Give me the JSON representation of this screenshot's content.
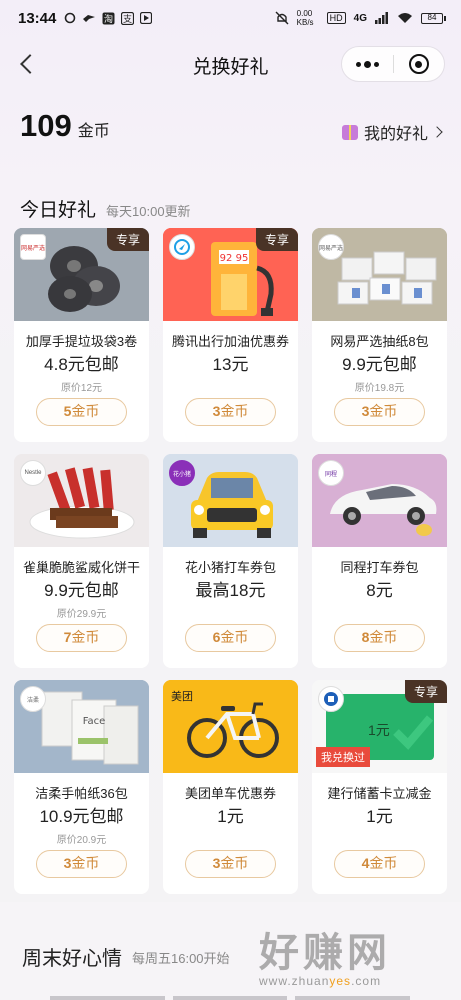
{
  "status_bar": {
    "time": "13:44",
    "left_icons": [
      "notification-icon",
      "bird-icon",
      "taobao-icon",
      "fund-icon",
      "play-icon"
    ],
    "speed": "0.00 KB/s",
    "hd": "HD",
    "network": "4G",
    "battery": "84"
  },
  "nav": {
    "title": "兑换好礼"
  },
  "wallet": {
    "coins": "109",
    "coins_unit": "金币",
    "my_gifts_label": "我的好礼"
  },
  "today": {
    "title": "今日好礼",
    "subtitle": "每天10:00更新"
  },
  "cards": [
    {
      "name": "加厚手提垃圾袋3卷",
      "price": "4.8元包邮",
      "original": "原价12元",
      "cost": "5",
      "unit": "金币",
      "tag": "专享",
      "brand": "网易严选",
      "image": "garbage-bags-image"
    },
    {
      "name": "腾讯出行加油优惠券",
      "price": "13元",
      "original": "",
      "cost": "3",
      "unit": "金币",
      "tag": "专享",
      "brand": "",
      "image": "gas-pump-image"
    },
    {
      "name": "网易严选抽纸8包",
      "price": "9.9元包邮",
      "original": "原价19.8元",
      "cost": "3",
      "unit": "金币",
      "tag": "",
      "brand": "网易严选",
      "image": "tissue-packs-image"
    },
    {
      "name": "雀巢脆脆鲨威化饼干",
      "price": "9.9元包邮",
      "original": "原价29.9元",
      "cost": "7",
      "unit": "金币",
      "tag": "",
      "brand": "Nestle",
      "image": "wafer-biscuits-image"
    },
    {
      "name": "花小猪打车券包",
      "price": "最高18元",
      "original": "",
      "cost": "6",
      "unit": "金币",
      "tag": "",
      "brand": "花小猪",
      "image": "taxi-car-image"
    },
    {
      "name": "同程打车券包",
      "price": "8元",
      "original": "",
      "cost": "8",
      "unit": "金币",
      "tag": "",
      "brand": "同程",
      "image": "white-car-image"
    },
    {
      "name": "洁柔手帕纸36包",
      "price": "10.9元包邮",
      "original": "原价20.9元",
      "cost": "3",
      "unit": "金币",
      "tag": "",
      "brand": "洁柔",
      "image": "handkerchief-tissue-image"
    },
    {
      "name": "美团单车优惠券",
      "price": "1元",
      "original": "",
      "cost": "3",
      "unit": "金币",
      "tag": "",
      "brand": "美团",
      "image": "bicycle-image"
    },
    {
      "name": "建行储蓄卡立减金",
      "price": "1元",
      "original": "",
      "cost": "4",
      "unit": "金币",
      "tag": "专享",
      "brand": "建行",
      "image": "bank-card-image",
      "card_text": "1元",
      "ribbon": "我兑换过"
    }
  ],
  "weekend": {
    "title": "周末好心情",
    "subtitle": "每周五16:00开始"
  },
  "watermark": {
    "main": "好赚网",
    "url_prefix": "www.zhuan",
    "url_highlight": "yes",
    "url_suffix": ".com"
  }
}
